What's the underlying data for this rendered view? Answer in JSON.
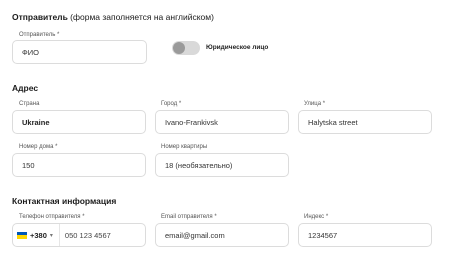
{
  "sender": {
    "title": "Отправитель",
    "note": "(форма заполняется на английском)",
    "name_label": "Отправитель *",
    "name_value": "ФИО",
    "legal_entity_label": "Юридическое лицо"
  },
  "address": {
    "title": "Адрес",
    "country_label": "Страна",
    "country_value": "Ukraine",
    "city_label": "Город *",
    "city_value": "Ivano-Frankivsk",
    "street_label": "Улица *",
    "street_value": "Halytska street",
    "house_label": "Номер дома *",
    "house_value": "150",
    "apartment_label": "Номер квартиры",
    "apartment_value": "18 (необязательно)"
  },
  "contact": {
    "title": "Контактная информация",
    "phone_label": "Телефон отправителя *",
    "phone_code": "+380",
    "phone_value": "050 123 4567",
    "email_label": "Email отправителя *",
    "email_value": "email@gmail.com",
    "zip_label": "Индекс *",
    "zip_value": "1234567"
  },
  "colors": {
    "flag_blue": "#0057b7",
    "flag_yellow": "#ffd700",
    "toggle_track": "#d9d9d9",
    "toggle_knob": "#9a9a9a",
    "border": "#dcdcdc"
  }
}
